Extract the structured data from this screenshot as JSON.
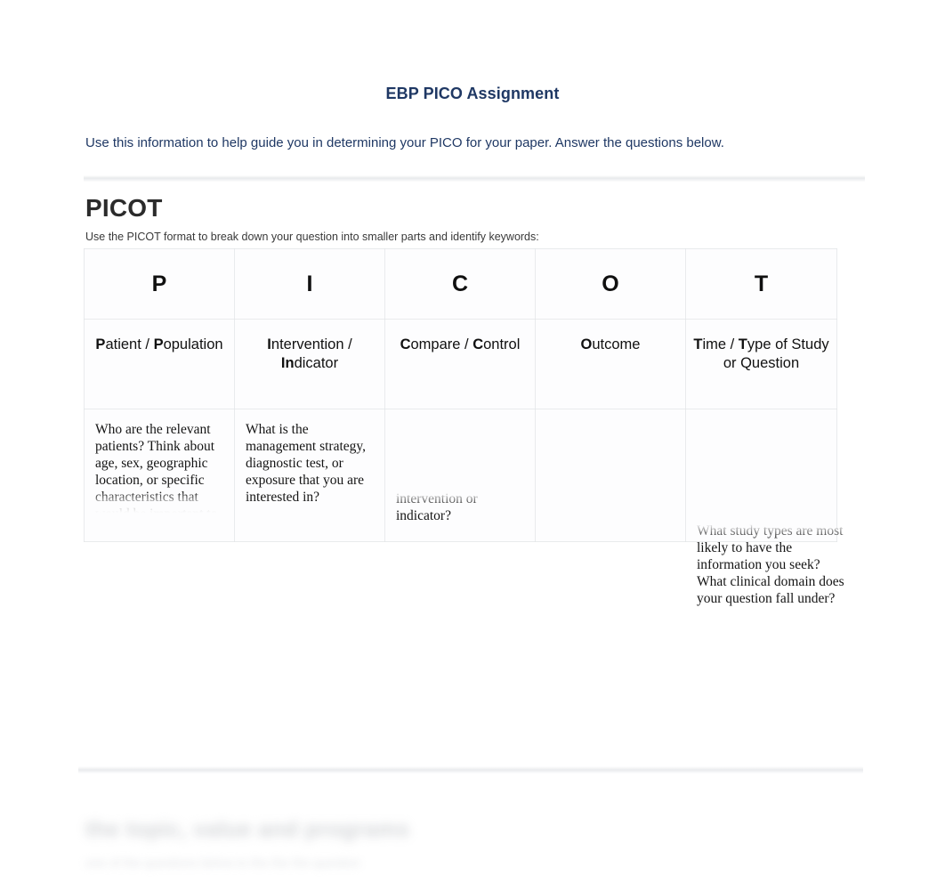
{
  "document": {
    "title": "EBP PICO Assignment",
    "intro": "Use this information to help guide you in determining your PICO for your paper.  Answer the questions below.",
    "title_color": "#1f3864",
    "body_color": "#141414"
  },
  "section": {
    "heading": "PICOT",
    "subheading": "Use the PICOT format to break down your question into smaller parts and identify keywords:"
  },
  "picot_table": {
    "letters": [
      "P",
      "I",
      "C",
      "O",
      "T"
    ],
    "names": [
      {
        "bold_1": "P",
        "rest_1": "atient / ",
        "bold_2": "P",
        "rest_2": "opulation",
        "plain": "Patient / Population"
      },
      {
        "bold_1": "I",
        "rest_1": "ntervention / ",
        "bold_2": "In",
        "rest_2": "dicator",
        "plain": "Intervention / Indicator"
      },
      {
        "bold_1": "C",
        "rest_1": "ompare / ",
        "bold_2": "C",
        "rest_2": "ontrol",
        "plain": "Compare / Control"
      },
      {
        "bold_1": "O",
        "rest_1": "utcome",
        "bold_2": "",
        "rest_2": "",
        "plain": "Outcome"
      },
      {
        "bold_1": "T",
        "rest_1": "ime / ",
        "bold_2": "T",
        "rest_2": "ype of Study or Question",
        "plain": "Time / Type of Study or Question"
      }
    ],
    "bodies": [
      "Who are the relevant patients? Think about age, sex, geographic location, or specific characteristics that would be important to",
      "What is the management strategy, diagnostic test, or exposure that you are interested in?",
      "intervention or indicator?",
      "",
      "What study types are most likely to have the information you seek?  What clinical domain does your question fall under?"
    ]
  },
  "bottom_section": {
    "blurred_heading": "the topic, value and programs",
    "blurred_line": "one of the questions below to the the the question"
  }
}
